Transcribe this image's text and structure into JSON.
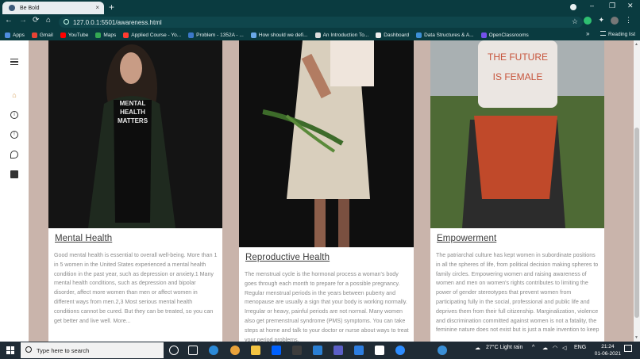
{
  "browser": {
    "tab_title": "Be Bold",
    "url": "127.0.0.1:5501/awareness.html",
    "new_tab": "+",
    "close_tab": "×",
    "minimize": "–",
    "restore": "❐",
    "close": "✕"
  },
  "bookmarks": {
    "items": [
      {
        "label": "Apps",
        "color": "#4f8de0"
      },
      {
        "label": "Gmail",
        "color": "#e84335"
      },
      {
        "label": "YouTube",
        "color": "#ff0000"
      },
      {
        "label": "Maps",
        "color": "#34a853"
      },
      {
        "label": "Applied Course - Yo...",
        "color": "#ff3b30"
      },
      {
        "label": "Problem - 1352A - ...",
        "color": "#3b78c9"
      },
      {
        "label": "How should we defi...",
        "color": "#6aa9e8"
      },
      {
        "label": "An Introduction To...",
        "color": "#dddddd"
      },
      {
        "label": "Dashboard",
        "color": "#eeeeee"
      },
      {
        "label": "Data Structures & A...",
        "color": "#3d8fd6"
      },
      {
        "label": "OpenClassrooms",
        "color": "#7451eb"
      }
    ],
    "more": "»",
    "reading_list": "Reading list"
  },
  "cards": [
    {
      "title": "Mental Health",
      "body": "Good mental health is essential to overall well-being. More than 1 in 5 women in the United States experienced a mental health condition in the past year, such as depression or anxiety.1 Many mental health conditions, such as depression and bipolar disorder, affect more women than men or affect women in different ways from men.2,3 Most serious mental health conditions cannot be cured. But they can be treated, so you can get better and live well. More..."
    },
    {
      "title": "Reproductive Health",
      "body": "The menstrual cycle is the hormonal process a woman's body goes through each month to prepare for a possible pregnancy. Regular menstrual periods in the years between puberty and menopause are usually a sign that your body is working normally. Irregular or heavy, painful periods are not normal. Many women also get premenstrual syndrome (PMS) symptoms. You can take steps at home and talk to your doctor or nurse about ways to treat your period problems."
    },
    {
      "title": "Empowerment",
      "body": "The patriarchal culture has kept women in subordinate positions in all the spheres of life, from political decision making spheres to family circles. Empowering women and raising awareness of women and men on women's rights contributes to limiting the power of gender stereotypes that prevent women from participating fully in the social, professional and public life and deprives them from their full citizenship. Marginalization, violence and discrimination committed against women is not a fatality, the feminine nature does not exist but is just a male invention to keep"
    }
  ],
  "photo_text": {
    "shirt": "MENTAL HEALTH MATTERS",
    "pillow_line1": "THE FUTURE",
    "pillow_line2": "IS FEMALE"
  },
  "taskbar": {
    "search_placeholder": "Type here to search",
    "weather": "27°C  Light rain",
    "language": "ENG",
    "time": "21:24",
    "date": "01-06-2021"
  }
}
